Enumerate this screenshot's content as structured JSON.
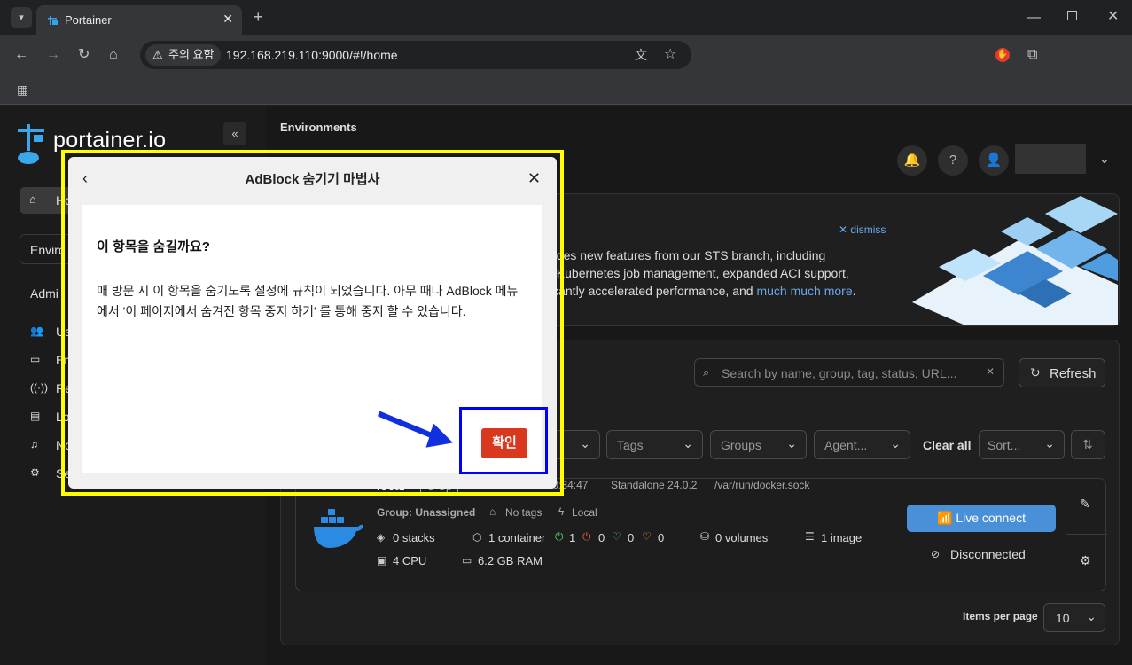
{
  "browser": {
    "tab_title": "Portainer",
    "security_chip": "주의 요함",
    "url": "192.168.219.110:9000/#!/home"
  },
  "sidebar": {
    "logo": "portainer.io",
    "items": [
      {
        "label": "Ho",
        "icon": "home-icon"
      },
      {
        "label": "Enviro",
        "icon": ""
      },
      {
        "label": "Admi",
        "icon": ""
      },
      {
        "label": "Us",
        "icon": "users-icon"
      },
      {
        "label": "En",
        "icon": "environments-icon"
      },
      {
        "label": "Re",
        "icon": "registries-icon"
      },
      {
        "label": "Lo",
        "icon": "logs-icon"
      },
      {
        "label": "No",
        "icon": "notifications-icon"
      },
      {
        "label": "Se",
        "icon": "settings-icon"
      }
    ]
  },
  "header": {
    "breadcrumb": "Environments"
  },
  "banner": {
    "dismiss": "dismiss",
    "line1": "udes new features from our STS branch, including",
    "line2": ", Kubernetes job management, expanded ACI support,",
    "line3": "icantly accelerated performance, and ",
    "link": "much much more",
    "line3_end": "."
  },
  "toolbar": {
    "search_placeholder": "Search by name, group, tag, status, URL...",
    "refresh": "Refresh"
  },
  "filters": {
    "tags": "Tags",
    "groups": "Groups",
    "agent": "Agent...",
    "clear_all": "Clear all",
    "sort": "Sort..."
  },
  "environment": {
    "name": "local",
    "status": "Up",
    "timestamp": "2025-03-18 10:34:47",
    "version": "Standalone 24.0.2",
    "socket": "/var/run/docker.sock",
    "group": "Group: Unassigned",
    "tags": "No tags",
    "location": "Local",
    "stacks": "0 stacks",
    "containers": "1 container",
    "running": "1",
    "stopped": "0",
    "healthy": "0",
    "unhealthy": "0",
    "volumes": "0 volumes",
    "images": "1 image",
    "cpu": "4 CPU",
    "ram": "6.2 GB RAM",
    "live_connect": "Live connect",
    "disconnected": "Disconnected"
  },
  "pagination": {
    "items_per_page_label": "Items per page",
    "items_per_page": "10"
  },
  "dialog": {
    "title": "AdBlock 숨기기 마법사",
    "question": "이 항목을 숨길까요?",
    "description": "매 방문 시 이 항목을 숨기도록 설정에 규칙이 되었습니다. 아무 때나 AdBlock 메뉴에서 '이 페이지에서 숨겨진 항목 중지 하기' 를 통해 중지 할 수 있습니다.",
    "confirm": "확인"
  },
  "colors": {
    "confirm_button": "#d9381e",
    "live_connect": "#4a90d9",
    "highlight_yellow": "#ffff00",
    "highlight_blue": "#0000ff"
  }
}
